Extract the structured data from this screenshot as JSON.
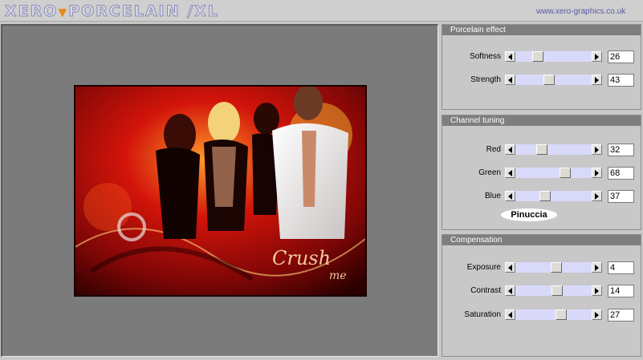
{
  "header": {
    "title_left": "XERO",
    "title_right": "PORCELAIN /XL",
    "site": "www.xero-graphics.co.uk"
  },
  "preview": {
    "overlay_text_1": "Crush",
    "overlay_text_2": "me"
  },
  "panels": {
    "porcelain": {
      "title": "Porcelain effect",
      "sliders": [
        {
          "label": "Softness",
          "value": "26",
          "level": 26
        },
        {
          "label": "Strength",
          "value": "43",
          "level": 43
        }
      ]
    },
    "channel": {
      "title": "Channel tuning",
      "sliders": [
        {
          "label": "Red",
          "value": "32",
          "level": 32
        },
        {
          "label": "Green",
          "value": "68",
          "level": 68
        },
        {
          "label": "Blue",
          "value": "37",
          "level": 37
        }
      ],
      "badge": "Pinuccia"
    },
    "compensation": {
      "title": "Compensation",
      "sliders": [
        {
          "label": "Exposure",
          "value": "4",
          "level": 54
        },
        {
          "label": "Contrast",
          "value": "14",
          "level": 56
        },
        {
          "label": "Saturation",
          "value": "27",
          "level": 62
        }
      ]
    }
  },
  "colors": {
    "accent": "#e58a1a",
    "header_bg": "#7e7e7e",
    "track": "#d9d9fa"
  }
}
